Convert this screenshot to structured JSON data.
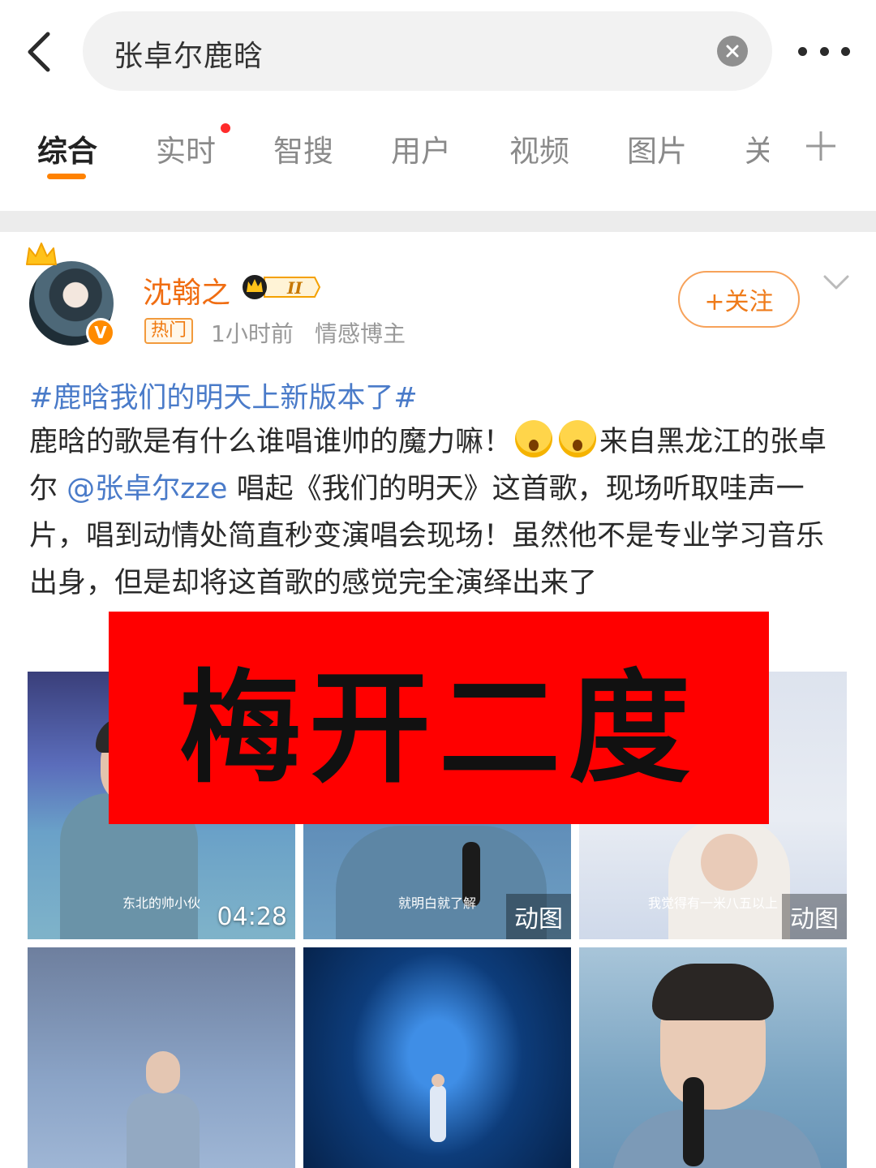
{
  "search": {
    "query": "张卓尔鹿晗"
  },
  "tabs": [
    {
      "label": "综合"
    },
    {
      "label": "实时"
    },
    {
      "label": "智搜"
    },
    {
      "label": "用户"
    },
    {
      "label": "视频"
    },
    {
      "label": "图片"
    },
    {
      "label": "关"
    }
  ],
  "post": {
    "username": "沈翰之",
    "vip_level": "II",
    "hot_tag": "热门",
    "time": "1小时前",
    "role": "情感博主",
    "follow_label": "+关注",
    "topic": "#鹿晗我们的明天上新版本了#",
    "text_part1": "鹿晗的歌是有什么谁唱谁帅的魔力嘛！",
    "text_part2": "来自黑龙江的张卓尔",
    "mention": "@张卓尔zze",
    "text_part3": "唱起《我们的明天》这首歌，现场听取哇声一片，唱到动情处简直秒变演唱会现场！虽然他不是专业学习音乐出身，但是却将这首歌的感觉完全演绎出来了"
  },
  "media": {
    "captions": [
      "东北的帅小伙",
      "就明白就了解",
      "我觉得有一米八五以上"
    ],
    "duration": "04:28",
    "gif_label": "动图"
  },
  "overlay": {
    "text": "梅开二度"
  },
  "colors": {
    "accent": "#ff8200",
    "link": "#4a7bc9",
    "overlay": "#ff0000"
  }
}
